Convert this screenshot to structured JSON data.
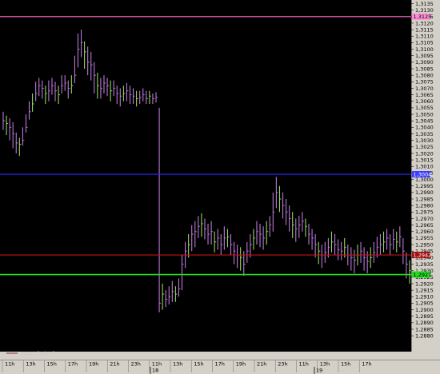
{
  "colors": {
    "background": "#000000",
    "bar": "#ba78d6",
    "bar_alt": "#8fd65a",
    "panel": "#d4d0c8",
    "legend_line": "#8a2a4a"
  },
  "legend": {
    "label": "EDM3 [Price]"
  },
  "chart_data": {
    "type": "bar",
    "subtype": "ohlc",
    "y_ticks": [
      "1,3135",
      "1,3130",
      "1,3125",
      "1,3120",
      "1,3115",
      "1,3110",
      "1,3105",
      "1,3100",
      "1,3095",
      "1,3090",
      "1,3085",
      "1,3080",
      "1,3075",
      "1,3070",
      "1,3065",
      "1,3060",
      "1,3055",
      "1,3050",
      "1,3045",
      "1,3040",
      "1,3035",
      "1,3030",
      "1,3025",
      "1,3020",
      "1,3015",
      "1,3010",
      "1,3005",
      "1,3000",
      "1,2995",
      "1,2990",
      "1,2985",
      "1,2980",
      "1,2975",
      "1,2970",
      "1,2965",
      "1,2960",
      "1,2955",
      "1,2950",
      "1,2945",
      "1,2940",
      "1,2935",
      "1,2930",
      "1,2925",
      "1,2920",
      "1,2915",
      "1,2910",
      "1,2905",
      "1,2900",
      "1,2895",
      "1,2890",
      "1,2885",
      "1,2880"
    ],
    "ylim": [
      1.288,
      1.3137
    ],
    "time_ticks": [
      "11h",
      "13h",
      "15h",
      "17h",
      "19h",
      "21h",
      "23h",
      "11h",
      "13h",
      "15h",
      "17h",
      "19h",
      "21h",
      "23h",
      "11h",
      "13h",
      "15h",
      "17h"
    ],
    "date_labels": [
      "18",
      "19"
    ],
    "hlines": [
      {
        "name": "magenta",
        "value": 1.3125,
        "color": "#ff6ec7",
        "label": "1,3125",
        "label_bg": "#ff8fd5"
      },
      {
        "name": "blue",
        "value": 1.3004,
        "color": "#2a2aff",
        "label": "1,3004",
        "label_bg": "#3c3cff"
      },
      {
        "name": "red",
        "value": 1.2942,
        "color": "#c41414",
        "label": "1,2942",
        "label_bg": "#a01010"
      },
      {
        "name": "green",
        "value": 1.2927,
        "color": "#22dd22",
        "label": "1,2927",
        "label_bg": "#22dd22"
      }
    ],
    "bars": [
      [
        1.3045,
        1.3052,
        1.3038
      ],
      [
        1.3043,
        1.3049,
        1.3034
      ],
      [
        1.304,
        1.3047,
        1.303
      ],
      [
        1.3035,
        1.3044,
        1.3024
      ],
      [
        1.3028,
        1.3036,
        1.302
      ],
      [
        1.3027,
        1.3032,
        1.3018
      ],
      [
        1.303,
        1.304,
        1.3026
      ],
      [
        1.304,
        1.305,
        1.3036
      ],
      [
        1.3052,
        1.306,
        1.3046
      ],
      [
        1.3058,
        1.3066,
        1.3052
      ],
      [
        1.3066,
        1.3075,
        1.306
      ],
      [
        1.3072,
        1.3078,
        1.3064
      ],
      [
        1.307,
        1.3076,
        1.3062
      ],
      [
        1.3066,
        1.3072,
        1.3058
      ],
      [
        1.3068,
        1.3076,
        1.306
      ],
      [
        1.3072,
        1.3078,
        1.3065
      ],
      [
        1.3068,
        1.3075,
        1.306
      ],
      [
        1.3065,
        1.3072,
        1.3058
      ],
      [
        1.3072,
        1.308,
        1.3066
      ],
      [
        1.3074,
        1.308,
        1.3068
      ],
      [
        1.307,
        1.3076,
        1.3062
      ],
      [
        1.3072,
        1.308,
        1.3066
      ],
      [
        1.308,
        1.3095,
        1.3074
      ],
      [
        1.31,
        1.3112,
        1.3086
      ],
      [
        1.3105,
        1.3115,
        1.3094
      ],
      [
        1.3098,
        1.3106,
        1.3085
      ],
      [
        1.309,
        1.3102,
        1.308
      ],
      [
        1.3088,
        1.3098,
        1.3076
      ],
      [
        1.308,
        1.309,
        1.3066
      ],
      [
        1.3072,
        1.3082,
        1.3062
      ],
      [
        1.307,
        1.3078,
        1.3062
      ],
      [
        1.3074,
        1.308,
        1.3066
      ],
      [
        1.3072,
        1.3078,
        1.3064
      ],
      [
        1.3068,
        1.3076,
        1.306
      ],
      [
        1.307,
        1.3076,
        1.3064
      ],
      [
        1.3066,
        1.3072,
        1.3058
      ],
      [
        1.3064,
        1.307,
        1.3056
      ],
      [
        1.3066,
        1.3072,
        1.306
      ],
      [
        1.3068,
        1.3074,
        1.306
      ],
      [
        1.3065,
        1.3072,
        1.3058
      ],
      [
        1.3064,
        1.307,
        1.3058
      ],
      [
        1.3062,
        1.3068,
        1.3056
      ],
      [
        1.3063,
        1.3068,
        1.3058
      ],
      [
        1.3065,
        1.307,
        1.306
      ],
      [
        1.3062,
        1.3068,
        1.3058
      ],
      [
        1.3064,
        1.3068,
        1.3058
      ],
      [
        1.3062,
        1.3066,
        1.3058
      ],
      [
        1.3063,
        1.3067,
        1.3059
      ],
      [
        1.2905,
        1.3055,
        1.2898
      ],
      [
        1.2912,
        1.292,
        1.29
      ],
      [
        1.2908,
        1.2915,
        1.2902
      ],
      [
        1.291,
        1.2918,
        1.2904
      ],
      [
        1.2914,
        1.2922,
        1.2906
      ],
      [
        1.2912,
        1.2918,
        1.2906
      ],
      [
        1.2916,
        1.2924,
        1.291
      ],
      [
        1.2935,
        1.2942,
        1.2915
      ],
      [
        1.2945,
        1.2952,
        1.2932
      ],
      [
        1.295,
        1.2958,
        1.294
      ],
      [
        1.2958,
        1.2965,
        1.2945
      ],
      [
        1.296,
        1.2968,
        1.2948
      ],
      [
        1.2964,
        1.2972,
        1.2955
      ],
      [
        1.2966,
        1.2974,
        1.2956
      ],
      [
        1.2962,
        1.297,
        1.2954
      ],
      [
        1.2958,
        1.2966,
        1.295
      ],
      [
        1.296,
        1.2968,
        1.295
      ],
      [
        1.2952,
        1.296,
        1.2944
      ],
      [
        1.2955,
        1.2962,
        1.2946
      ],
      [
        1.295,
        1.2958,
        1.2942
      ],
      [
        1.2955,
        1.2964,
        1.2946
      ],
      [
        1.2956,
        1.2962,
        1.2948
      ],
      [
        1.295,
        1.2958,
        1.2942
      ],
      [
        1.2945,
        1.2952,
        1.2935
      ],
      [
        1.2942,
        1.295,
        1.2932
      ],
      [
        1.294,
        1.2948,
        1.293
      ],
      [
        1.2935,
        1.2945,
        1.2926
      ],
      [
        1.2945,
        1.2952,
        1.2936
      ],
      [
        1.295,
        1.2958,
        1.294
      ],
      [
        1.2955,
        1.2962,
        1.2946
      ],
      [
        1.296,
        1.2968,
        1.295
      ],
      [
        1.2958,
        1.2966,
        1.2948
      ],
      [
        1.2955,
        1.2964,
        1.2946
      ],
      [
        1.296,
        1.2968,
        1.295
      ],
      [
        1.2965,
        1.2972,
        1.2956
      ],
      [
        1.2975,
        1.299,
        1.296
      ],
      [
        1.299,
        1.3002,
        1.2978
      ],
      [
        1.2985,
        1.2995,
        1.2975
      ],
      [
        1.298,
        1.299,
        1.297
      ],
      [
        1.2975,
        1.2985,
        1.2965
      ],
      [
        1.297,
        1.298,
        1.296
      ],
      [
        1.2965,
        1.2975,
        1.2955
      ],
      [
        1.2962,
        1.297,
        1.2952
      ],
      [
        1.2965,
        1.2972,
        1.2955
      ],
      [
        1.2968,
        1.2975,
        1.296
      ],
      [
        1.2964,
        1.297,
        1.2956
      ],
      [
        1.2958,
        1.2966,
        1.295
      ],
      [
        1.2955,
        1.2962,
        1.2946
      ],
      [
        1.295,
        1.2958,
        1.294
      ],
      [
        1.2945,
        1.2952,
        1.2935
      ],
      [
        1.2942,
        1.295,
        1.2932
      ],
      [
        1.2944,
        1.2952,
        1.2936
      ],
      [
        1.2948,
        1.2955,
        1.294
      ],
      [
        1.2952,
        1.296,
        1.2944
      ],
      [
        1.295,
        1.2958,
        1.2942
      ],
      [
        1.2946,
        1.2954,
        1.2938
      ],
      [
        1.2945,
        1.2952,
        1.2938
      ],
      [
        1.2948,
        1.2955,
        1.294
      ],
      [
        1.2942,
        1.295,
        1.2934
      ],
      [
        1.294,
        1.2948,
        1.293
      ],
      [
        1.2938,
        1.2946,
        1.2928
      ],
      [
        1.2942,
        1.295,
        1.2934
      ],
      [
        1.2945,
        1.2952,
        1.2936
      ],
      [
        1.294,
        1.2948,
        1.293
      ],
      [
        1.2937,
        1.2945,
        1.2928
      ],
      [
        1.294,
        1.2948,
        1.2932
      ],
      [
        1.2944,
        1.2952,
        1.2936
      ],
      [
        1.2948,
        1.2956,
        1.294
      ],
      [
        1.295,
        1.2958,
        1.2942
      ],
      [
        1.2952,
        1.296,
        1.2944
      ],
      [
        1.2955,
        1.2962,
        1.2946
      ],
      [
        1.295,
        1.2958,
        1.2942
      ],
      [
        1.2954,
        1.2962,
        1.2946
      ],
      [
        1.2952,
        1.296,
        1.2944
      ],
      [
        1.2956,
        1.2964,
        1.2948
      ],
      [
        1.2945,
        1.2955,
        1.2935
      ],
      [
        1.2935,
        1.2944,
        1.2924
      ],
      [
        1.293,
        1.2938,
        1.292
      ]
    ],
    "ohlc_fields": [
      "close",
      "high",
      "low"
    ]
  }
}
